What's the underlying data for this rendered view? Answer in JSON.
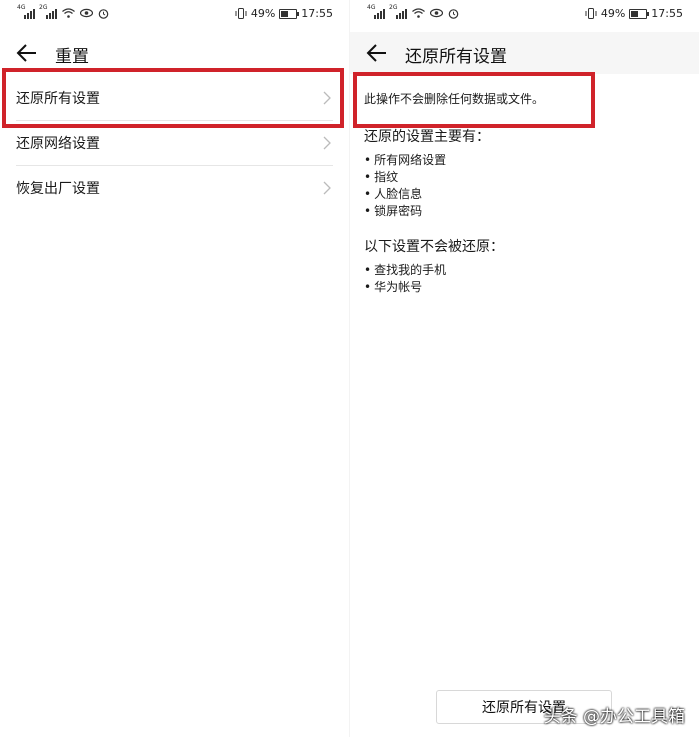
{
  "status": {
    "net1": "4G",
    "net2": "2G",
    "battery": "49%",
    "battery_level": 0.49,
    "time": "17:55"
  },
  "left_screen": {
    "title": "重置",
    "items": [
      {
        "label": "还原所有设置"
      },
      {
        "label": "还原网络设置"
      },
      {
        "label": "恢复出厂设置"
      }
    ]
  },
  "right_screen": {
    "title": "还原所有设置",
    "warning": "此操作不会删除任何数据或文件。",
    "reset_heading": "还原的设置主要有：",
    "reset_items": [
      "所有网络设置",
      "指纹",
      "人脸信息",
      "锁屏密码"
    ],
    "keep_heading": "以下设置不会被还原：",
    "keep_items": [
      "查找我的手机",
      "华为帐号"
    ],
    "button_label": "还原所有设置"
  },
  "watermark": "头条 @办公工具箱",
  "colors": {
    "highlight": "#d0232a"
  },
  "icons": [
    "signal-icon",
    "wifi-icon",
    "eye-icon",
    "alarm-icon",
    "vibrate-icon",
    "battery-icon",
    "back-arrow-icon",
    "chevron-right-icon"
  ]
}
